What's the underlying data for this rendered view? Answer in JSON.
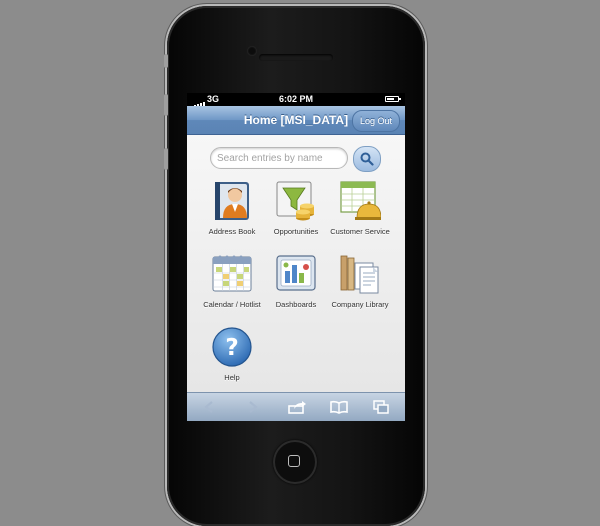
{
  "status": {
    "network": "3G",
    "time": "6:02 PM"
  },
  "nav": {
    "title": "Home [MSI_DATA]",
    "logout_label": "Log Out"
  },
  "search": {
    "placeholder": "Search entries by name"
  },
  "tiles": [
    {
      "label": "Address Book",
      "icon": "address-book-icon"
    },
    {
      "label": "Opportunities",
      "icon": "opportunities-icon"
    },
    {
      "label": "Customer Service",
      "icon": "customer-service-icon"
    },
    {
      "label": "Calendar / Hotlist",
      "icon": "calendar-icon"
    },
    {
      "label": "Dashboards",
      "icon": "dashboards-icon"
    },
    {
      "label": "Company Library",
      "icon": "company-library-icon"
    },
    {
      "label": "Help",
      "icon": "help-icon"
    }
  ],
  "toolbar": {
    "buttons": [
      "back-arrow-icon",
      "forward-arrow-icon",
      "share-icon",
      "bookmarks-icon",
      "pages-icon"
    ]
  },
  "colors": {
    "nav_blue": "#6f97c6",
    "toolbar_blue": "#93a9c2",
    "background": "#8c8c8c"
  }
}
